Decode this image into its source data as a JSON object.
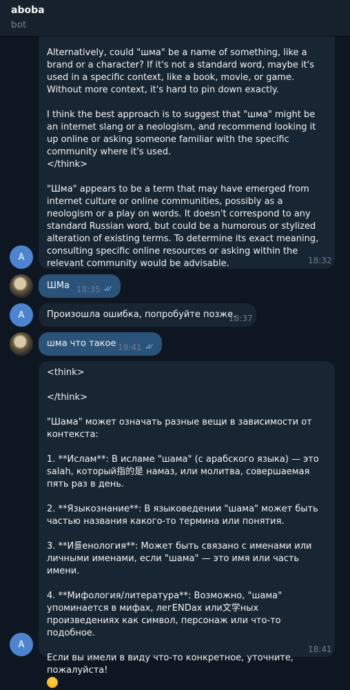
{
  "chat": {
    "title": "aboba",
    "status": "bot"
  },
  "messages": {
    "m1": {
      "text": "word or sound effect.\n\nAlternatively, could \"шма\" be a name of something, like a brand or a character? If it's not a standard word, maybe it's used in a specific context, like a book, movie, or game. Without more context, it's hard to pin down exactly.\n\nI think the best approach is to suggest that \"шма\" might be an internet slang or a neologism, and recommend looking it up online or asking someone familiar with the specific community where it's used.\n</think>\n\n\"Шма\" appears to be a term that may have emerged from internet culture or online communities, possibly as a neologism or a play on words. It doesn't correspond to any standard Russian word, but could be a humorous or stylized alteration of existing terms. To determine its exact meaning, consulting specific online resources or asking within the relevant community would be advisable.",
      "time": "18:32",
      "avatar_letter": "A"
    },
    "m2": {
      "text": "ШМа",
      "time": "18:35"
    },
    "m3": {
      "text": "Произошла ошибка, попробуйте позже.",
      "time": "18:37",
      "avatar_letter": "A"
    },
    "m4": {
      "text": "шма что такое",
      "time": "18:41"
    },
    "m5": {
      "text": "<think>\n\n</think>\n\n\"Шама\" может означать разные вещи в зависимости от контекста:\n\n1. **Ислам**: В исламе \"шама\" (с арабского языка) — это salah, который指的是 намаз, или молитва, совершаемая пять раз в день.\n\n2. **Языкознание**: В языковедении \"шама\" может быть частью названия какого-то термина или понятия.\n\n3. **И를енология**: Может быть связано с именами или личными именами, если \"шама\" — это имя или часть имени.\n\n4. **Мифология/литература**: Возможно, \"шама\" упоминается в мифах, легENDах или文学ных произведениях как символ, персонаж или что-то подобное.\n\nЕсли вы имели в виду что-то конкретное, уточните, пожалуйста!",
      "time": "18:41",
      "avatar_letter": "A"
    }
  },
  "icons": {
    "read_receipt": "double-check-icon",
    "emoji": "smiling-face-icon"
  },
  "colors": {
    "background": "#0e1621",
    "incoming": "#182533",
    "outgoing": "#2b5278",
    "accent": "#4e84cf"
  }
}
